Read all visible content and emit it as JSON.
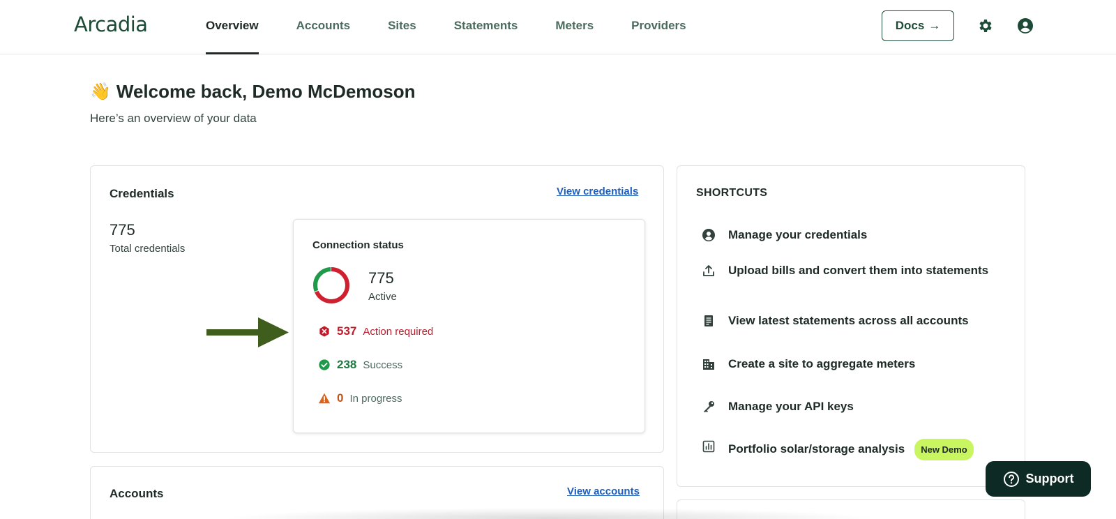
{
  "header": {
    "logo": "Arcadia",
    "nav": [
      {
        "label": "Overview",
        "active": true
      },
      {
        "label": "Accounts",
        "active": false
      },
      {
        "label": "Sites",
        "active": false
      },
      {
        "label": "Statements",
        "active": false
      },
      {
        "label": "Meters",
        "active": false
      },
      {
        "label": "Providers",
        "active": false
      }
    ],
    "docs_label": "Docs",
    "docs_arrow": "→",
    "icons": [
      "gear-icon",
      "user-circle-icon"
    ]
  },
  "welcome": {
    "emoji": "👋",
    "title": "Welcome back, Demo McDemoson",
    "subtitle": "Here’s an overview of your data"
  },
  "credentials": {
    "title": "Credentials",
    "link": "View credentials",
    "total": "775",
    "total_label": "Total credentials",
    "status": {
      "title": "Connection status",
      "active_count": "775",
      "active_label": "Active",
      "rows": [
        {
          "count": "537",
          "label": "Action required",
          "icon": "error-hexagon-icon",
          "color": "#c21b2c"
        },
        {
          "count": "238",
          "label": "Success",
          "icon": "check-circle-icon",
          "color": "#1d7a3f"
        },
        {
          "count": "0",
          "label": "In progress",
          "icon": "warning-triangle-icon",
          "color": "#c2561b"
        }
      ],
      "donut": {
        "action_required": 537,
        "success": 238,
        "in_progress": 0
      }
    }
  },
  "shortcuts": {
    "title": "SHORTCUTS",
    "items": [
      {
        "label": "Manage your credentials",
        "icon": "user-circle-icon"
      },
      {
        "label": "Upload bills and convert them into statements",
        "icon": "upload-icon"
      },
      {
        "label": "View latest statements across all accounts",
        "icon": "document-icon"
      },
      {
        "label": "Create a site to aggregate meters",
        "icon": "building-icon"
      },
      {
        "label": "Manage your API keys",
        "icon": "key-icon"
      },
      {
        "label": "Portfolio solar/storage analysis",
        "icon": "chart-icon",
        "badge": "New Demo"
      }
    ]
  },
  "accounts": {
    "title": "Accounts",
    "link": "View accounts"
  },
  "support": {
    "label": "Support"
  },
  "colors": {
    "brand": "#1d4a36",
    "link": "#1d5fbf",
    "badge": "#c8f560",
    "support_bg": "#0e2a24"
  }
}
